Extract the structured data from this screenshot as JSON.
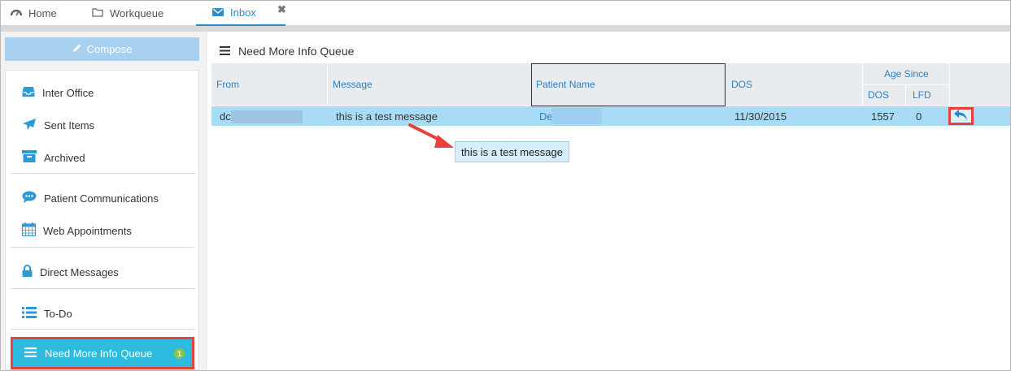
{
  "tabs": [
    {
      "label": "Home",
      "icon": "dashboard-icon"
    },
    {
      "label": "Workqueue",
      "icon": "folder-icon"
    },
    {
      "label": "Inbox",
      "icon": "envelope-icon",
      "active": true
    }
  ],
  "sidebar": {
    "compose_label": "Compose",
    "items": [
      {
        "label": "Inter Office",
        "icon": "inbox-tray-icon"
      },
      {
        "label": "Sent Items",
        "icon": "paper-plane-icon"
      },
      {
        "label": "Archived",
        "icon": "archive-box-icon"
      },
      {
        "label": "Patient Communications",
        "icon": "chat-bubble-icon"
      },
      {
        "label": "Web Appointments",
        "icon": "calendar-icon"
      },
      {
        "label": "Direct Messages",
        "icon": "lock-icon"
      },
      {
        "label": "To-Do",
        "icon": "list-icon"
      },
      {
        "label": "Need More Info Queue",
        "icon": "hamburger-icon",
        "active": true,
        "badge": "1"
      }
    ]
  },
  "main": {
    "title": "Need More Info Queue",
    "columns": {
      "from": "From",
      "message": "Message",
      "patient_name": "Patient Name",
      "dos": "DOS",
      "age_since": "Age Since",
      "age_dos": "DOS",
      "age_lfd": "LFD"
    },
    "rows": [
      {
        "from": "dc",
        "message": "this is a test message",
        "patient_name": "De",
        "dos": "11/30/2015",
        "age_dos": "1557",
        "age_lfd": "0"
      }
    ],
    "tooltip": "this is a test message"
  },
  "colors": {
    "accent": "#2d89c8",
    "active_sidebar": "#2dbbe0",
    "highlight_border": "#e8413c",
    "selected_row": "#a8dcf6",
    "badge": "#8cc63f"
  }
}
